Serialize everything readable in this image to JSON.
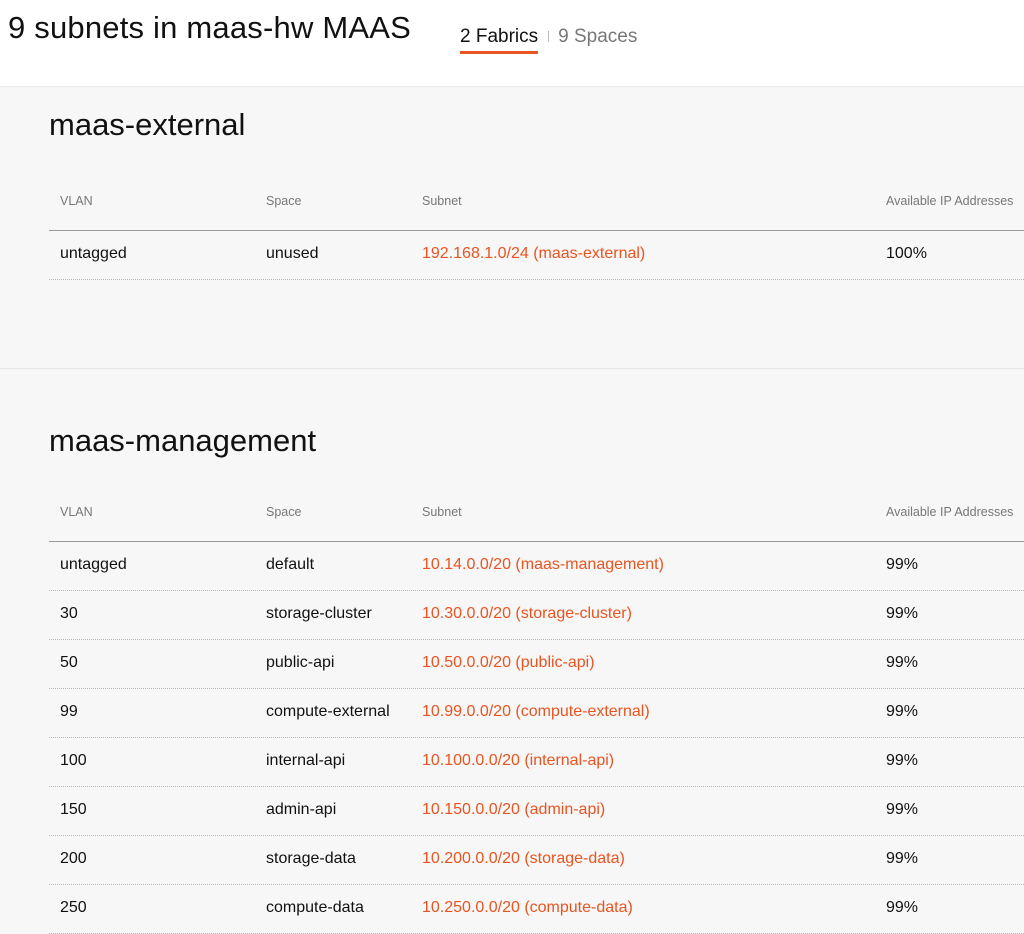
{
  "header": {
    "title": "9 subnets in maas-hw MAAS",
    "tabs": [
      {
        "label": "2 Fabrics",
        "active": true
      },
      {
        "label": "9 Spaces",
        "active": false
      }
    ]
  },
  "columns": [
    "VLAN",
    "Space",
    "Subnet",
    "Available IP Addresses"
  ],
  "fabrics": [
    {
      "name": "maas-external",
      "rows": [
        {
          "vlan": "untagged",
          "space": "unused",
          "subnet": "192.168.1.0/24 (maas-external)",
          "available": "100%"
        }
      ]
    },
    {
      "name": "maas-management",
      "rows": [
        {
          "vlan": "untagged",
          "space": "default",
          "subnet": "10.14.0.0/20 (maas-management)",
          "available": "99%"
        },
        {
          "vlan": "30",
          "space": "storage-cluster",
          "subnet": "10.30.0.0/20 (storage-cluster)",
          "available": "99%"
        },
        {
          "vlan": "50",
          "space": "public-api",
          "subnet": "10.50.0.0/20 (public-api)",
          "available": "99%"
        },
        {
          "vlan": "99",
          "space": "compute-external",
          "subnet": "10.99.0.0/20 (compute-external)",
          "available": "99%"
        },
        {
          "vlan": "100",
          "space": "internal-api",
          "subnet": "10.100.0.0/20 (internal-api)",
          "available": "99%"
        },
        {
          "vlan": "150",
          "space": "admin-api",
          "subnet": "10.150.0.0/20 (admin-api)",
          "available": "99%"
        },
        {
          "vlan": "200",
          "space": "storage-data",
          "subnet": "10.200.0.0/20 (storage-data)",
          "available": "99%"
        },
        {
          "vlan": "250",
          "space": "compute-data",
          "subnet": "10.250.0.0/20 (compute-data)",
          "available": "99%"
        }
      ]
    }
  ],
  "colors": {
    "accent": "#e95420",
    "text": "#111111",
    "muted": "#777777",
    "background": "#f7f7f7"
  }
}
